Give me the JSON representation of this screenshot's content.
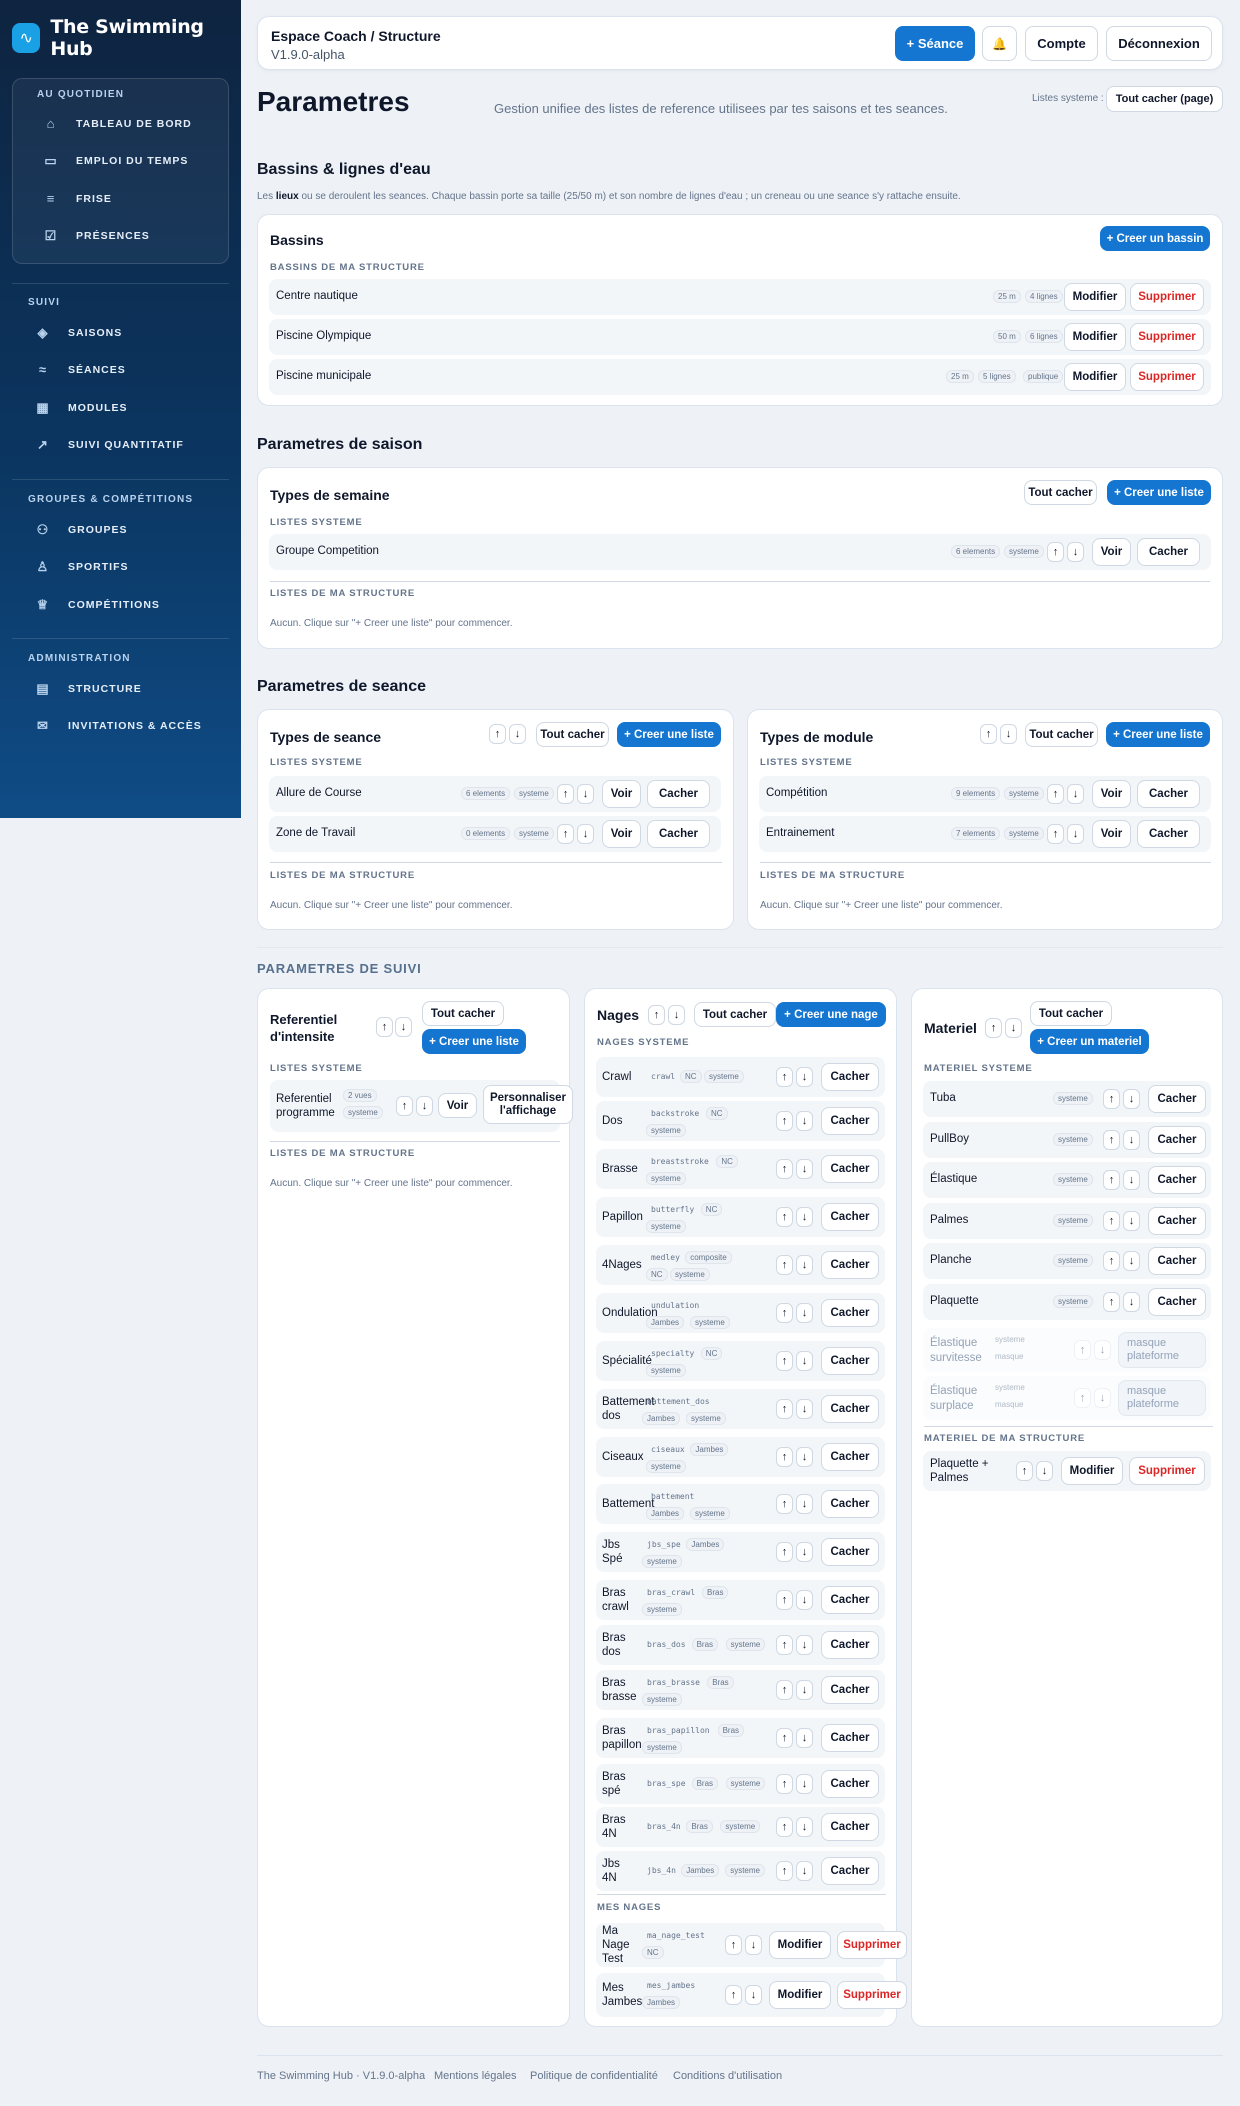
{
  "app": {
    "name": "The Swimming Hub"
  },
  "sidebar": {
    "sec1": "AU QUOTIDIEN",
    "sec2": "SUIVI",
    "sec3": "GROUPES & COMPÉTITIONS",
    "sec4": "ADMINISTRATION",
    "items": [
      "TABLEAU DE BORD",
      "EMPLOI DU TEMPS",
      "FRISE",
      "PRÉSENCES",
      "SAISONS",
      "SÉANCES",
      "MODULES",
      "SUIVI QUANTITATIF",
      "GROUPES",
      "SPORTIFS",
      "COMPÉTITIONS",
      "STRUCTURE",
      "INVITATIONS & ACCÈS"
    ]
  },
  "topbar": {
    "title": "Espace Coach / Structure",
    "version": "V1.9.0-alpha",
    "new_session": "+ Séance",
    "bell": "🔔",
    "account": "Compte",
    "logout": "Déconnexion"
  },
  "page": {
    "title": "Parametres",
    "subtitle": "Gestion unifiee des listes de reference utilisees par tes saisons et tes seances.",
    "system_lists_label": "Listes systeme :",
    "hide_all_page": "Tout cacher (page)"
  },
  "common": {
    "edit": "Modifier",
    "delete": "Supprimer",
    "view": "Voir",
    "hide": "Cacher",
    "hide_all": "Tout cacher",
    "create_list": "+ Creer une liste",
    "system": "systeme",
    "masked": "masque",
    "empty": "Aucun. Clique sur \"+ Creer une liste\" pour commencer.",
    "system_lists": "LISTES SYSTEME",
    "my_lists": "LISTES DE MA STRUCTURE",
    "up": "↑",
    "down": "↓"
  },
  "bassins": {
    "heading": "Bassins & lignes d'eau",
    "desc_pre": "Les ",
    "desc_bold": "lieux",
    "desc_post": " ou se deroulent les seances. Chaque bassin porte sa taille (25/50 m) et son nombre de lignes d'eau ; un creneau ou une seance s'y rattache ensuite.",
    "card_title": "Bassins",
    "create": "+ Creer un bassin",
    "group_label": "BASSINS DE MA STRUCTURE",
    "rows": [
      {
        "name": "Centre nautique",
        "size": "25 m",
        "lanes": "4 lignes"
      },
      {
        "name": "Piscine Olympique",
        "size": "50 m",
        "lanes": "6 lignes"
      },
      {
        "name": "Piscine municipale",
        "size": "25 m",
        "lanes": "5 lignes",
        "extra": "publique"
      }
    ]
  },
  "saison": {
    "heading": "Parametres de saison",
    "card_title": "Types de semaine",
    "rows": [
      {
        "name": "Groupe Competition",
        "count": "6 elements"
      }
    ]
  },
  "seance": {
    "heading": "Parametres de seance",
    "types_seance": {
      "title": "Types de seance",
      "rows": [
        {
          "name": "Allure de Course",
          "count": "6 elements"
        },
        {
          "name": "Zone de Travail",
          "count": "0 elements"
        }
      ]
    },
    "types_module": {
      "title": "Types de module",
      "rows": [
        {
          "name": "Compétition",
          "count": "9 elements"
        },
        {
          "name": "Entrainement",
          "count": "7 elements"
        }
      ]
    }
  },
  "suivi": {
    "heading": "PARAMETRES DE SUIVI",
    "intensite": {
      "title_l1": "Referentiel",
      "title_l2": "d'intensite",
      "row_l1": "Referentiel",
      "row_l2": "programme",
      "views": "2 vues",
      "custom_l1": "Personnaliser",
      "custom_l2": "l'affichage"
    },
    "nages": {
      "title": "Nages",
      "create": "+ Creer une nage",
      "sys_label": "NAGES SYSTEME",
      "mine_label": "MES NAGES",
      "rows": [
        {
          "l1": "Crawl",
          "code": "crawl",
          "t": [
            "NC",
            "systeme"
          ]
        },
        {
          "l1": "Dos",
          "code": "backstroke",
          "t": [
            "NC"
          ],
          "t2": [
            "systeme"
          ]
        },
        {
          "l1": "Brasse",
          "code": "breaststroke",
          "t": [
            "NC"
          ],
          "t2": [
            "systeme"
          ]
        },
        {
          "l1": "Papillon",
          "code": "butterfly",
          "t": [
            "NC"
          ],
          "t2": [
            "systeme"
          ]
        },
        {
          "l1": "4Nages",
          "code": "medley",
          "t": [
            "composite"
          ],
          "t2": [
            "NC",
            "systeme"
          ]
        },
        {
          "l1": "Ondulation",
          "code": "undulation",
          "t": [],
          "t2": [
            "Jambes",
            "systeme"
          ]
        },
        {
          "l1": "Spécialité",
          "code": "specialty",
          "t": [
            "NC"
          ],
          "t2": [
            "systeme"
          ]
        },
        {
          "l1": "Battement",
          "l2": "dos",
          "code": "battement_dos",
          "t": [],
          "t2": [
            "Jambes",
            "systeme"
          ]
        },
        {
          "l1": "Ciseaux",
          "code": "ciseaux",
          "t": [
            "Jambes"
          ],
          "t2": [
            "systeme"
          ]
        },
        {
          "l1": "Battement",
          "code": "battement",
          "t": [],
          "t2": [
            "Jambes",
            "systeme"
          ]
        },
        {
          "l1": "Jbs",
          "l2": "Spé",
          "code": "jbs_spe",
          "t": [
            "Jambes"
          ],
          "t2": [
            "systeme"
          ]
        },
        {
          "l1": "Bras",
          "l2": "crawl",
          "code": "bras_crawl",
          "t": [
            "Bras"
          ],
          "t2": [
            "systeme"
          ]
        },
        {
          "l1": "Bras",
          "l2": "dos",
          "code": "bras_dos",
          "t": [
            "Bras",
            "systeme"
          ]
        },
        {
          "l1": "Bras",
          "l2": "brasse",
          "code": "bras_brasse",
          "t": [
            "Bras"
          ],
          "t2": [
            "systeme"
          ]
        },
        {
          "l1": "Bras",
          "l2": "papillon",
          "code": "bras_papillon",
          "t": [
            "Bras"
          ],
          "t2": [
            "systeme"
          ]
        },
        {
          "l1": "Bras",
          "l2": "spé",
          "code": "bras_spe",
          "t": [
            "Bras",
            "systeme"
          ]
        },
        {
          "l1": "Bras",
          "l2": "4N",
          "code": "bras_4n",
          "t": [
            "Bras",
            "systeme"
          ]
        },
        {
          "l1": "Jbs",
          "l2": "4N",
          "code": "jbs_4n",
          "t": [
            "Jambes",
            "systeme"
          ]
        }
      ],
      "mine": [
        {
          "l1": "Ma",
          "l2": "Nage",
          "l3": "Test",
          "code": "ma_nage_test",
          "t2": [
            "NC"
          ]
        },
        {
          "l1": "Mes",
          "l2": "Jambes",
          "code": "mes_jambes",
          "t2": [
            "Jambes"
          ]
        }
      ]
    },
    "materiel": {
      "title": "Materiel",
      "create": "+ Creer un materiel",
      "sys_label": "MATERIEL SYSTEME",
      "mine_label": "MATERIEL DE MA STRUCTURE",
      "rows": [
        "Tuba",
        "PullBoy",
        "Élastique",
        "Palmes",
        "Planche",
        "Plaquette"
      ],
      "masked": [
        {
          "l1": "Élastique",
          "l2": "survitesse"
        },
        {
          "l1": "Élastique",
          "l2": "surplace"
        }
      ],
      "unmask_l1": "masque",
      "unmask_l2": "plateforme",
      "mine": [
        {
          "l1": "Plaquette +",
          "l2": "Palmes"
        }
      ]
    }
  },
  "footer": {
    "copy": "The Swimming Hub · V1.9.0-alpha",
    "legal": "Mentions légales",
    "privacy": "Politique de confidentialité",
    "terms": "Conditions d'utilisation"
  }
}
